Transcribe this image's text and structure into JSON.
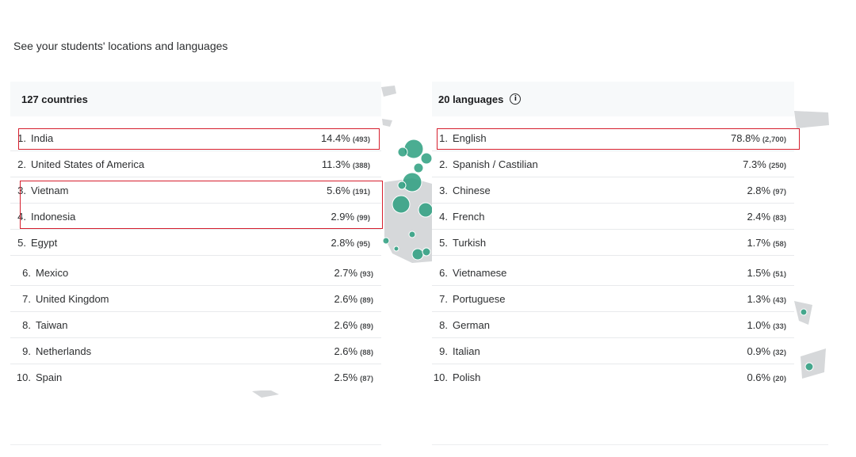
{
  "heading": "See your students' locations and languages",
  "countries": {
    "title": "127 countries",
    "items": [
      {
        "rank": "1.",
        "name": "India",
        "pct": "14.4%",
        "count": "(493)"
      },
      {
        "rank": "2.",
        "name": "United States of America",
        "pct": "11.3%",
        "count": "(388)"
      },
      {
        "rank": "3.",
        "name": "Vietnam",
        "pct": "5.6%",
        "count": "(191)"
      },
      {
        "rank": "4.",
        "name": "Indonesia",
        "pct": "2.9%",
        "count": "(99)"
      },
      {
        "rank": "5.",
        "name": "Egypt",
        "pct": "2.8%",
        "count": "(95)"
      },
      {
        "rank": "6.",
        "name": "Mexico",
        "pct": "2.7%",
        "count": "(93)"
      },
      {
        "rank": "7.",
        "name": "United Kingdom",
        "pct": "2.6%",
        "count": "(89)"
      },
      {
        "rank": "8.",
        "name": "Taiwan",
        "pct": "2.6%",
        "count": "(89)"
      },
      {
        "rank": "9.",
        "name": "Netherlands",
        "pct": "2.6%",
        "count": "(88)"
      },
      {
        "rank": "10.",
        "name": "Spain",
        "pct": "2.5%",
        "count": "(87)"
      }
    ]
  },
  "languages": {
    "title": "20 languages",
    "items": [
      {
        "rank": "1.",
        "name": "English",
        "pct": "78.8%",
        "count": "(2,700)"
      },
      {
        "rank": "2.",
        "name": "Spanish / Castilian",
        "pct": "7.3%",
        "count": "(250)"
      },
      {
        "rank": "3.",
        "name": "Chinese",
        "pct": "2.8%",
        "count": "(97)"
      },
      {
        "rank": "4.",
        "name": "French",
        "pct": "2.4%",
        "count": "(83)"
      },
      {
        "rank": "5.",
        "name": "Turkish",
        "pct": "1.7%",
        "count": "(58)"
      },
      {
        "rank": "6.",
        "name": "Vietnamese",
        "pct": "1.5%",
        "count": "(51)"
      },
      {
        "rank": "7.",
        "name": "Portuguese",
        "pct": "1.3%",
        "count": "(43)"
      },
      {
        "rank": "8.",
        "name": "German",
        "pct": "1.0%",
        "count": "(33)"
      },
      {
        "rank": "9.",
        "name": "Italian",
        "pct": "0.9%",
        "count": "(32)"
      },
      {
        "rank": "10.",
        "name": "Polish",
        "pct": "0.6%",
        "count": "(20)"
      }
    ]
  },
  "colors": {
    "highlight": "#d61f2e",
    "map_bubble": "#2c9f7f",
    "header_bg": "#f7f9fa"
  },
  "icons": {
    "languages_info": "info-icon"
  }
}
